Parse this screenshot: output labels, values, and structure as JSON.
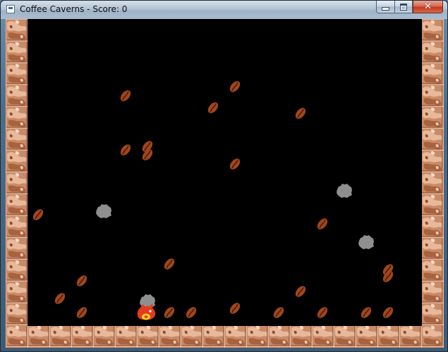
{
  "window": {
    "title": "Coffee Caverns - Score: 0"
  },
  "title_icons": {
    "app": "app-icon",
    "minimize": "minimize-icon",
    "maximize": "maximize-icon",
    "close": "close-icon"
  },
  "colors": {
    "cavern_background": "#000000",
    "wall_rock_base": "#c98a66",
    "wall_rock_light": "#f0c9b0",
    "wall_rock_dark": "#8c4e2e",
    "coffee_bean": "#a0461e",
    "coffee_bean_crease": "#4a1a06",
    "boulder": "#8f8f8f",
    "player_body": "#e23b1f",
    "player_accent": "#ffd21a"
  },
  "game": {
    "score": 0,
    "coffee_bean_count": 26,
    "boulder_count": 4,
    "player_count": 1
  }
}
